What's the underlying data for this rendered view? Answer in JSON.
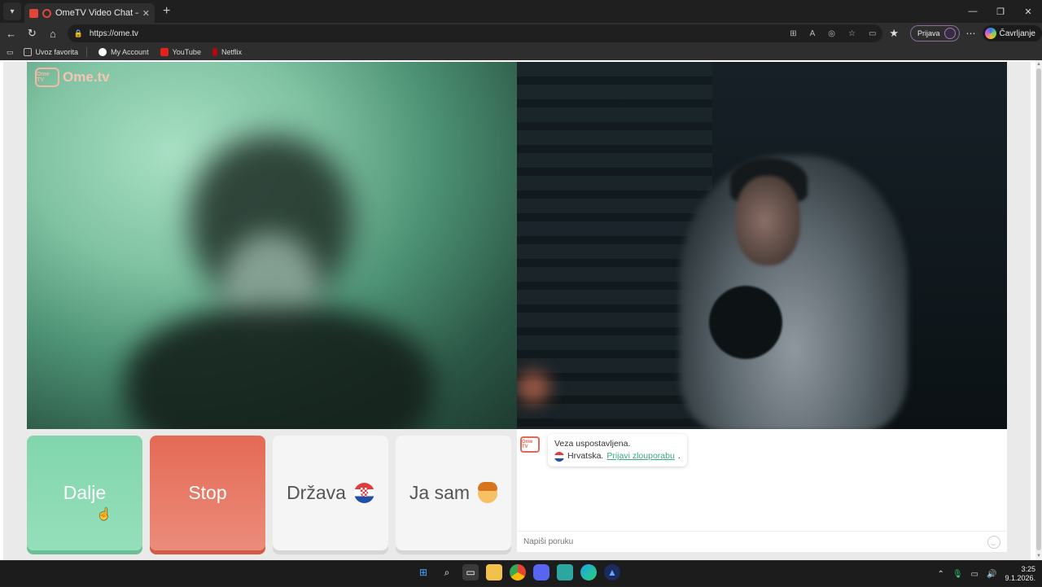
{
  "browser": {
    "tab_title": "OmeTV Video Chat — Omegl",
    "url": "https://ome.tv",
    "profile_label": "Prijava",
    "copilot_label": "Čavrljanje",
    "bookmarks": [
      {
        "label": "Uvoz favorita",
        "icon": "import-icon"
      },
      {
        "label": "My Account",
        "icon": "google-icon"
      },
      {
        "label": "YouTube",
        "icon": "youtube-icon"
      },
      {
        "label": "Netflix",
        "icon": "netflix-icon"
      }
    ]
  },
  "app": {
    "logo_text": "Ome.tv",
    "logo_badge": "Ome TV",
    "buttons": {
      "next": "Dalje",
      "stop": "Stop",
      "country": "Država",
      "iam": "Ja sam"
    },
    "chat": {
      "system_message": "Veza uspostavljena.",
      "country": "Hrvatska.",
      "report_link": "Prijavi zlouporabu",
      "report_suffix": ".",
      "input_placeholder": "Napiši poruku"
    }
  },
  "taskbar": {
    "time": "3:25",
    "date": "9.1.2026."
  },
  "colors": {
    "next": "#81d6ad",
    "stop": "#e46a55",
    "link": "#3aa88a"
  }
}
